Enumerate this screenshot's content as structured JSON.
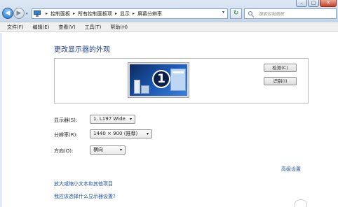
{
  "window": {
    "controls": {
      "minimize": "–",
      "maximize": "□",
      "close": "✕"
    }
  },
  "nav": {
    "back_glyph": "◀",
    "forward_glyph": "▶",
    "dropdown_glyph": "▾",
    "breadcrumb": [
      "控制面板",
      "所有控制面板项",
      "显示",
      "屏幕分辨率"
    ],
    "separator": "▸",
    "address_dropdown_glyph": "▾",
    "refresh_glyph": "↻",
    "search_placeholder": "搜索控制面板",
    "icons": {
      "address": "control-panel-icon",
      "search": "search-icon"
    }
  },
  "menu": {
    "items": [
      "文件(F)",
      "编辑(E)",
      "查看(V)",
      "工具(T)",
      "帮助(H)"
    ]
  },
  "main": {
    "heading": "更改显示器的外观",
    "monitor_number": "1",
    "detect_button": "检测(C)",
    "identify_button": "识别(I)",
    "display_label": "显示器(S):",
    "display_value": "1. L197 Wide",
    "resolution_label": "分辨率(R):",
    "resolution_value": "1440 × 900 (推荐)",
    "orientation_label": "方向(O):",
    "orientation_value": "横向",
    "dropdown_glyph": "▾",
    "advanced_link": "高级设置",
    "link_text_size": "放大或缩小文本和其他项目",
    "link_which_settings": "我应该选择什么显示器设置?"
  },
  "colors": {
    "link": "#1f4fa0",
    "heading": "#1f3c88",
    "close_button": "#c8432a"
  }
}
